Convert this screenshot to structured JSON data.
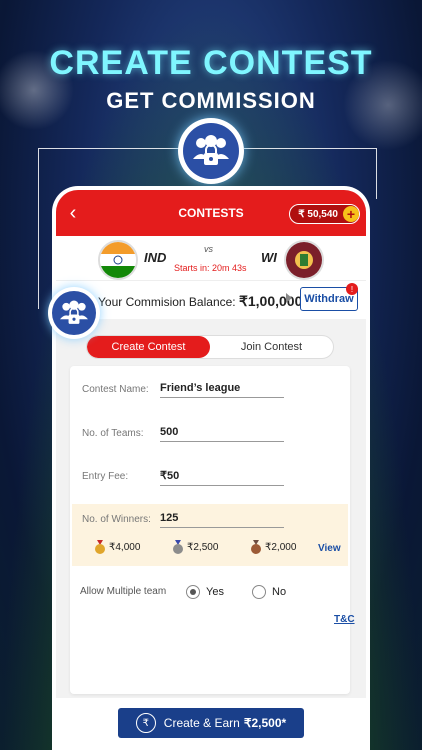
{
  "promo": {
    "headline": "CREATE CONTEST",
    "subheadline": "GET COMMISSION"
  },
  "header": {
    "back_icon": "chevron-left-icon",
    "title": "CONTESTS",
    "wallet_balance": "₹ 50,540",
    "wallet_add": "+"
  },
  "match": {
    "team1": "IND",
    "vs": "vs",
    "team2": "WI",
    "countdown": "Starts in: 20m 43s"
  },
  "commission": {
    "label": "Your Commision Balance: ",
    "amount": "₹1,00,000",
    "withdraw_label": "Withdraw",
    "alert": "!"
  },
  "tabs": [
    {
      "label": "Create Contest",
      "active": true
    },
    {
      "label": "Join Contest",
      "active": false
    }
  ],
  "form": {
    "contest_name": {
      "label": "Contest Name:",
      "value": "Friend’s league"
    },
    "teams": {
      "label": "No. of Teams:",
      "value": "500"
    },
    "entry_fee": {
      "label": "Entry Fee:",
      "value": "₹50"
    },
    "winners": {
      "label": "No. of Winners:",
      "value": "125"
    },
    "prizes": [
      {
        "medal": "gold",
        "amount": "₹4,000"
      },
      {
        "medal": "silver",
        "amount": "₹2,500"
      },
      {
        "medal": "bronze",
        "amount": "₹2,000"
      }
    ],
    "view_label": "View",
    "multiple_team": {
      "label": "Allow Multiple team",
      "options": [
        "Yes",
        "No"
      ],
      "selected": "Yes"
    }
  },
  "tnc_label": "T&C",
  "cta": {
    "coin": "₹",
    "label": "Create & Earn",
    "amount": "₹2,500*"
  },
  "colors": {
    "primary_red": "#e41c1c",
    "primary_blue": "#1a3f8a",
    "accent_cyan": "#7ff6ff"
  }
}
